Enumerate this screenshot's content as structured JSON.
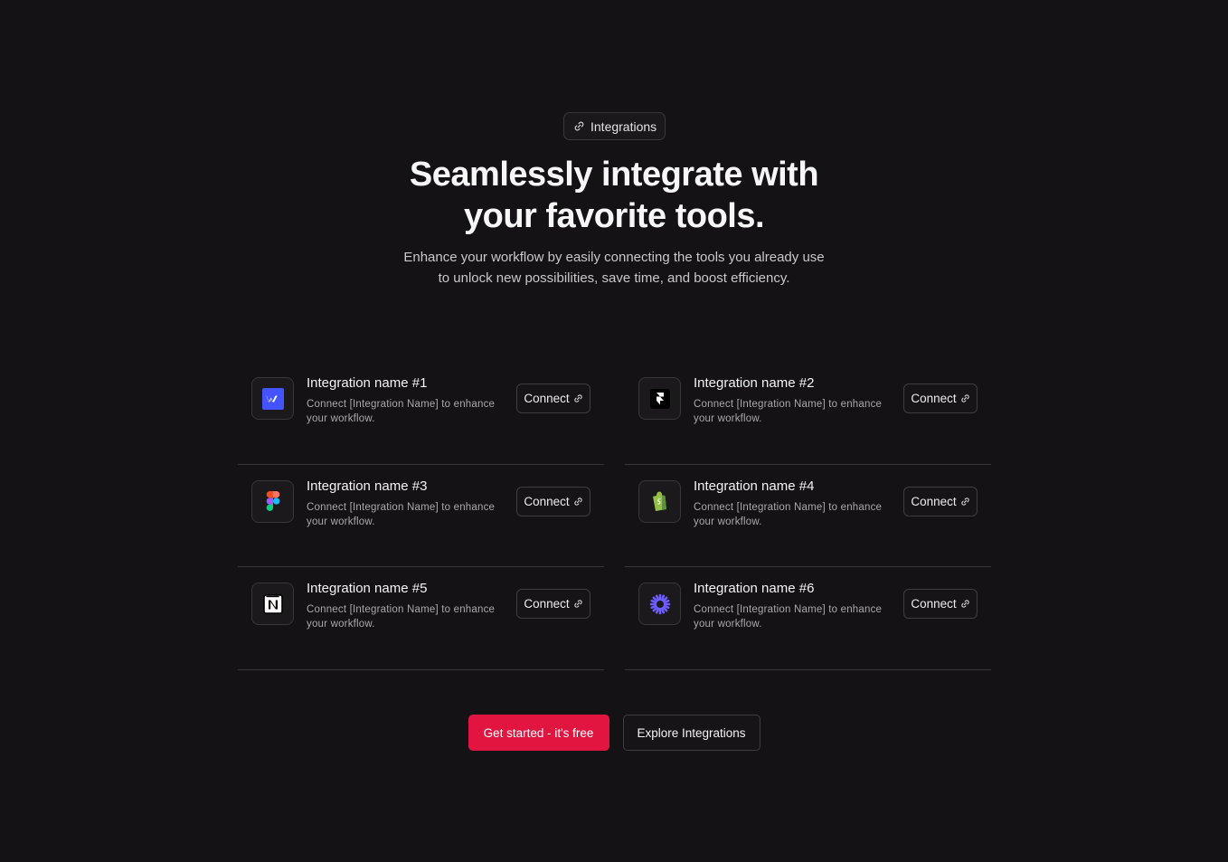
{
  "badge": {
    "label": "Integrations",
    "icon": "link-icon"
  },
  "hero": {
    "title_line1": "Seamlessly integrate with",
    "title_line2": "your favorite tools.",
    "subtitle_line1": "Enhance your workflow by easily connecting the tools you already use",
    "subtitle_line2": "to unlock new possibilities, save time, and boost efficiency."
  },
  "integrations": [
    {
      "name": "Integration name #1",
      "description": "Connect [Integration Name] to enhance your workflow.",
      "icon": "webflow-icon",
      "connect_label": "Connect"
    },
    {
      "name": "Integration name #2",
      "description": "Connect [Integration Name] to enhance your workflow.",
      "icon": "framer-icon",
      "connect_label": "Connect"
    },
    {
      "name": "Integration name #3",
      "description": "Connect [Integration Name] to enhance your workflow.",
      "icon": "figma-icon",
      "connect_label": "Connect"
    },
    {
      "name": "Integration name #4",
      "description": "Connect [Integration Name] to enhance your workflow.",
      "icon": "shopify-icon",
      "connect_label": "Connect"
    },
    {
      "name": "Integration name #5",
      "description": "Connect [Integration Name] to enhance your workflow.",
      "icon": "notion-icon",
      "connect_label": "Connect"
    },
    {
      "name": "Integration name #6",
      "description": "Connect [Integration Name] to enhance your workflow.",
      "icon": "zapier-burst-icon",
      "connect_label": "Connect"
    }
  ],
  "cta": {
    "primary_label": "Get started - it's free",
    "secondary_label": "Explore Integrations"
  },
  "colors": {
    "background": "#141215",
    "accent": "#e21440",
    "webflow": "#4353ff",
    "shopify": "#95bf47",
    "burst": "#6d5cff"
  }
}
